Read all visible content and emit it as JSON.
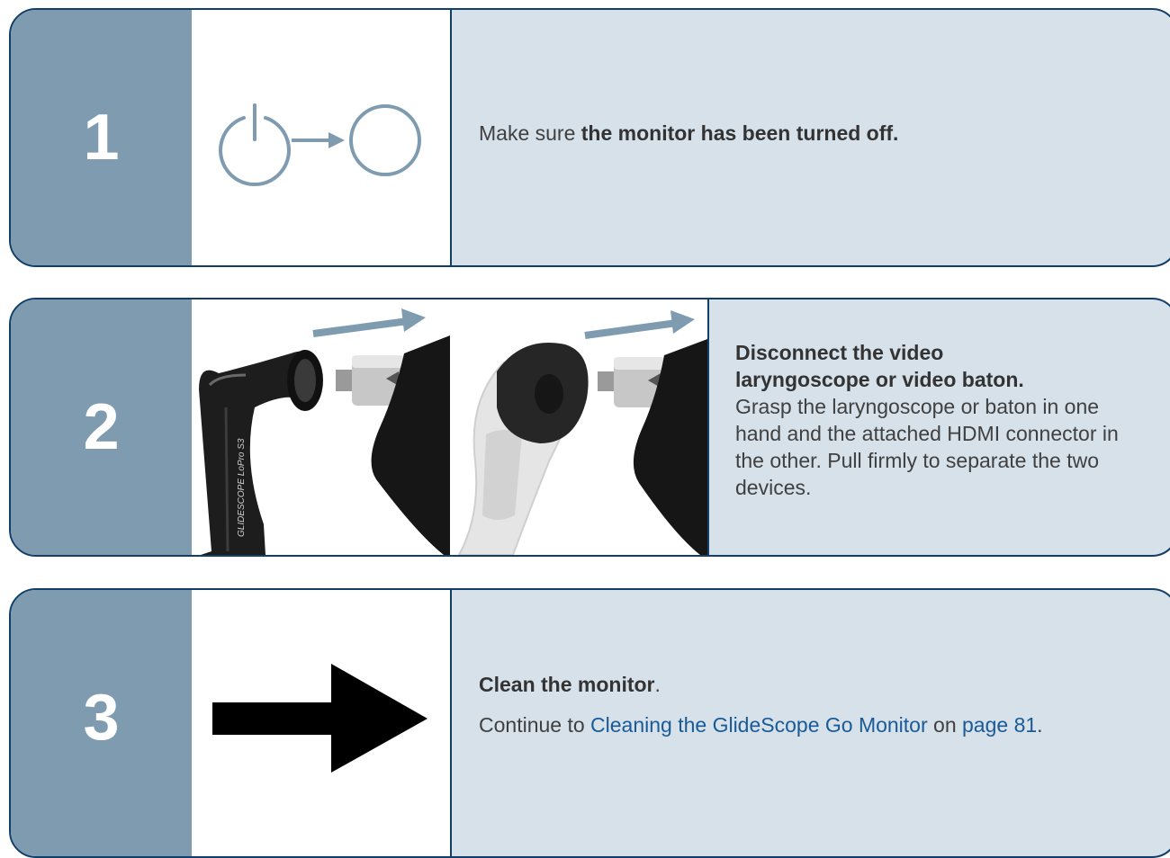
{
  "steps": [
    {
      "number": "1",
      "icon": "power-off-to-circle-icon",
      "text_prefix": "Make sure ",
      "text_bold": "the monitor has been turned off."
    },
    {
      "number": "2",
      "icon": "disconnect-photos",
      "device_label": "GLIDESCOPE LoPro S3",
      "heading": "Disconnect the video laryngoscope or video baton.",
      "body": "Grasp the laryngoscope or baton in one hand and the attached HDMI connector in the other. Pull firmly to separate the two devices."
    },
    {
      "number": "3",
      "icon": "right-arrow-icon",
      "heading_bold": "Clean the monitor",
      "heading_end": ".",
      "continue_prefix": "Continue to ",
      "continue_link": "Cleaning the GlideScope Go Monitor",
      "continue_mid": " on ",
      "page_link": "page 81",
      "continue_end": "."
    }
  ],
  "colors": {
    "number_column": "#7e9bb0",
    "text_column": "#d6e1ea",
    "border": "#123e6a",
    "link": "#1a5a96",
    "icon_stroke": "#7e9bb0"
  }
}
